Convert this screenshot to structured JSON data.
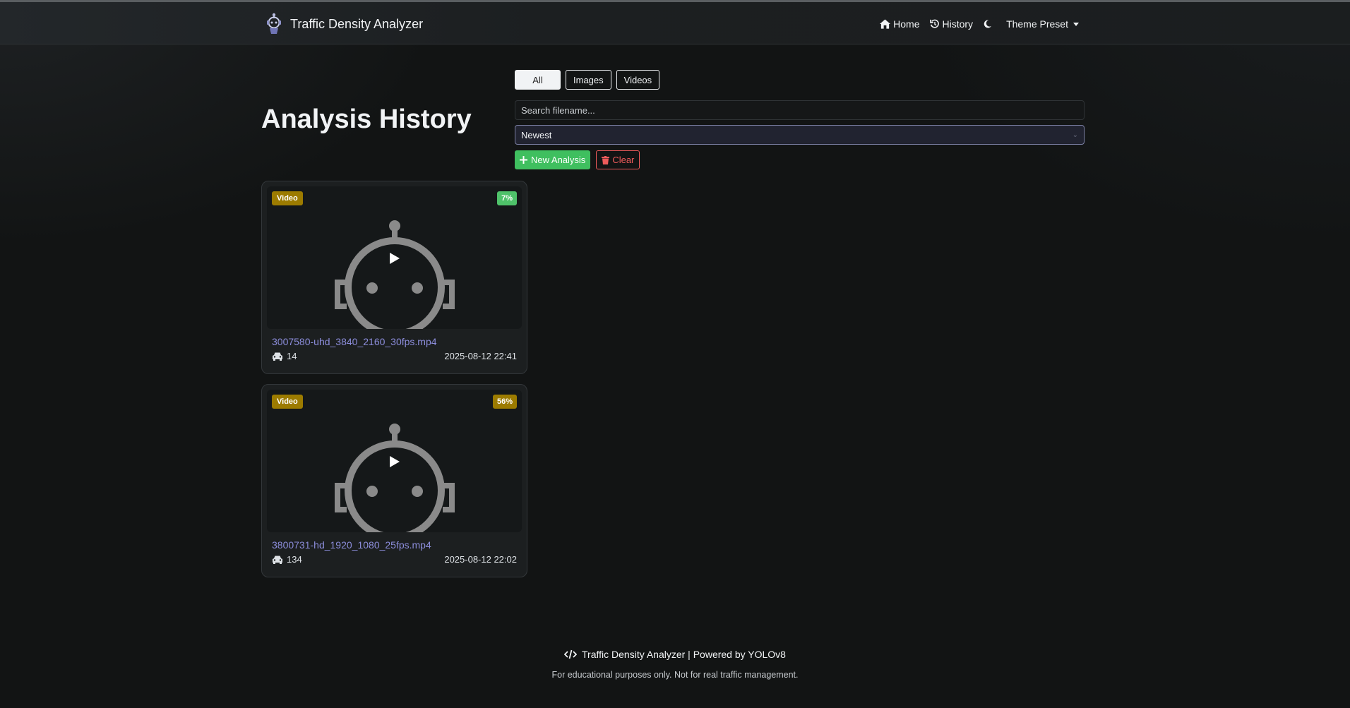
{
  "navbar": {
    "brand": "Traffic Density Analyzer",
    "links": {
      "home": "Home",
      "history": "History",
      "theme_preset": "Theme Preset"
    }
  },
  "page": {
    "title": "Analysis History"
  },
  "filters": {
    "all": "All",
    "images": "Images",
    "videos": "Videos",
    "active": "All"
  },
  "search": {
    "placeholder": "Search filename...",
    "value": ""
  },
  "sort": {
    "selected": "Newest"
  },
  "actions": {
    "new_analysis": "New Analysis",
    "clear": "Clear"
  },
  "cards": [
    {
      "type": "Video",
      "percent": "7%",
      "percent_color": "#4fc26a",
      "filename": "3007580-uhd_3840_2160_30fps.mp4",
      "vehicle_count": "14",
      "date": "2025-08-12 22:41"
    },
    {
      "type": "Video",
      "percent": "56%",
      "percent_color": "#9c7b00",
      "filename": "3800731-hd_1920_1080_25fps.mp4",
      "vehicle_count": "134",
      "date": "2025-08-12 22:02"
    }
  ],
  "footer": {
    "line1": "Traffic Density Analyzer | Powered by YOLOv8",
    "line2": "For educational purposes only. Not for real traffic management."
  },
  "colors": {
    "accent_green": "#3fbf5f",
    "danger": "#ef5b5b",
    "warning": "#9c7b00",
    "link": "#8c8ddb"
  }
}
